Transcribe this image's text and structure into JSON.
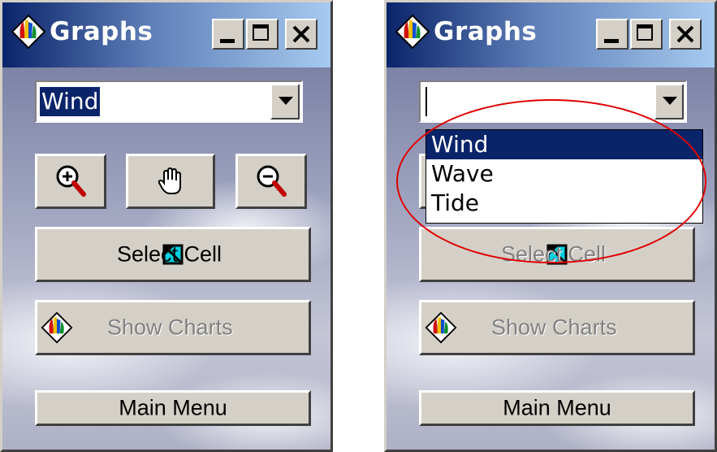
{
  "left_window": {
    "title": "Graphs",
    "combo_value": "Wind",
    "select_cell_label": "Select Cell",
    "show_charts_label": "Show Charts",
    "main_menu_label": "Main Menu"
  },
  "right_window": {
    "title": "Graphs",
    "combo_value": "",
    "dropdown_options": [
      "Wind",
      "Wave",
      "Tide"
    ],
    "selected_option": "Wind",
    "select_cell_label": "Select Cell",
    "show_charts_label": "Show Charts",
    "main_menu_label": "Main Menu"
  },
  "icons": {
    "title": "graphs-app-icon",
    "zoom_in": "zoom-in-icon",
    "pan": "hand-pan-icon",
    "zoom_out": "zoom-out-icon",
    "select_cell": "select-cell-icon",
    "show_charts": "charts-icon"
  },
  "colors": {
    "highlight": "#0a246a",
    "annotation": "#e00000",
    "face": "#d4d0c8"
  }
}
